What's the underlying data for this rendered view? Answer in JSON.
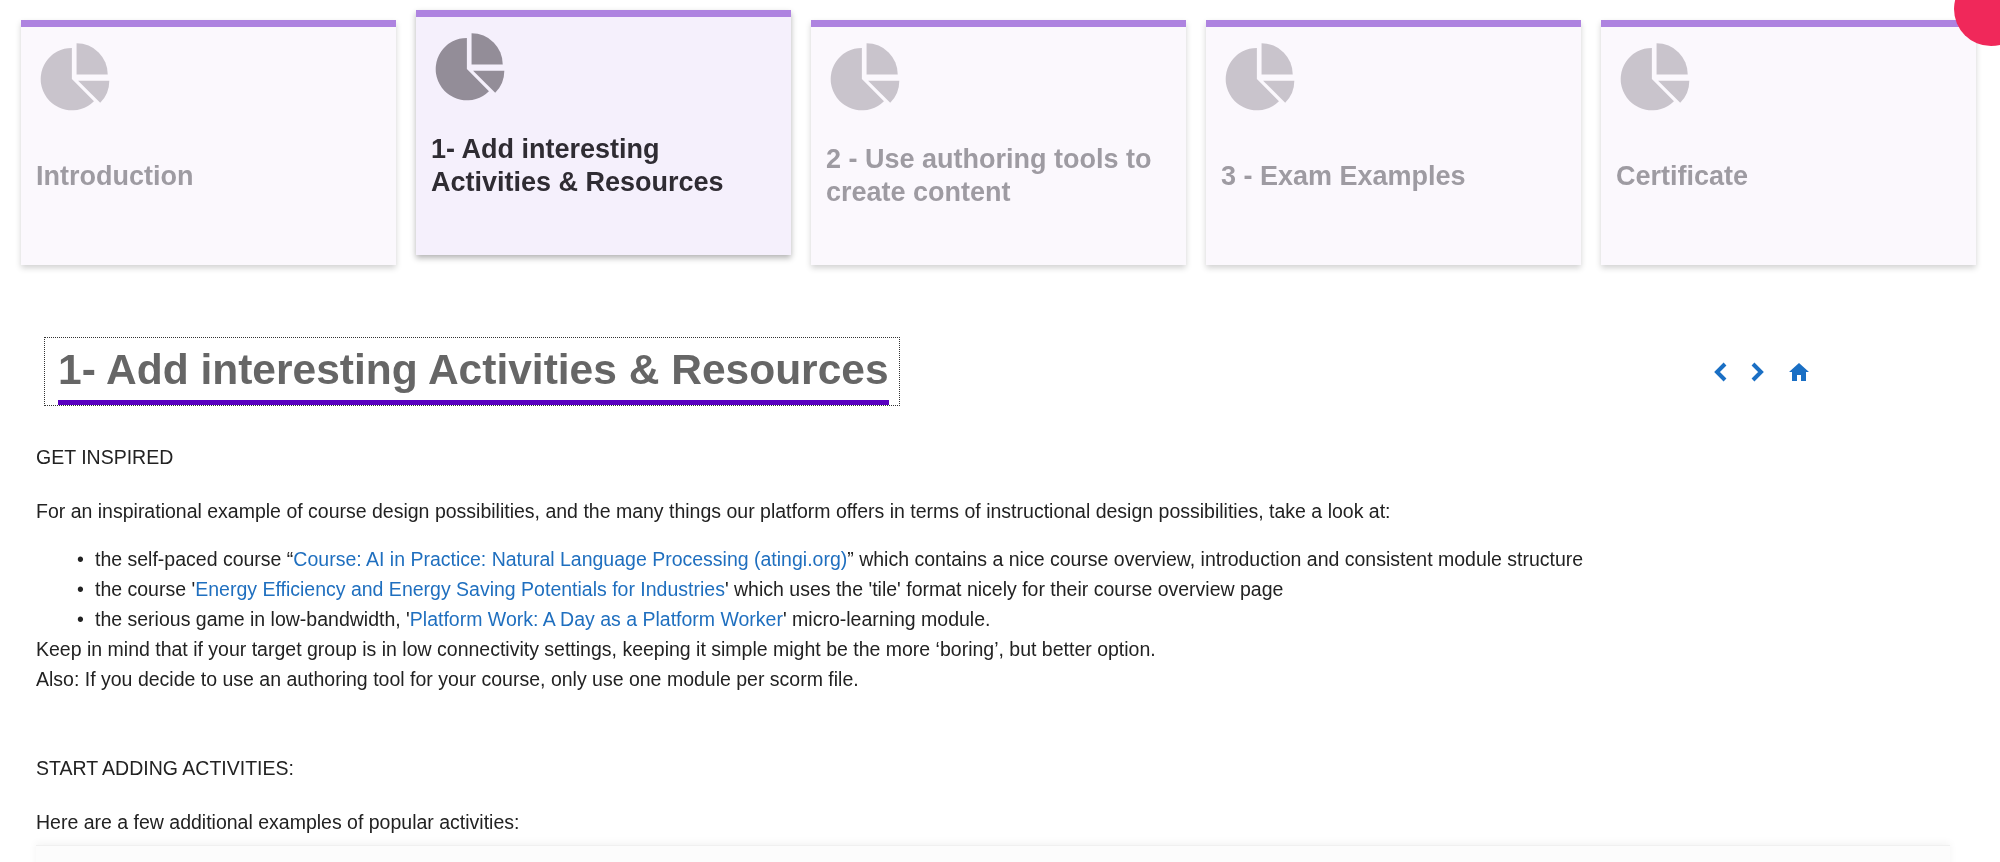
{
  "tiles": [
    {
      "title": "Introduction",
      "selected": false
    },
    {
      "title": "1- Add interesting Activities & Resources",
      "selected": true
    },
    {
      "title": "2 - Use authoring tools to create content",
      "selected": false
    },
    {
      "title": "3 - Exam Examples",
      "selected": false
    },
    {
      "title": "Certificate",
      "selected": false
    }
  ],
  "heading": "1- Add interesting Activities & Resources",
  "blocks": [
    {
      "kind": "paragraph",
      "spans": [
        {
          "kind": "text",
          "text": "GET INSPIRED"
        }
      ]
    },
    {
      "kind": "paragraph",
      "spans": [
        {
          "kind": "text",
          "text": "For an inspirational example of course design possibilities, and the many things our platform offers in terms of instructional design possibilities, take a look at:"
        }
      ]
    },
    {
      "kind": "list",
      "items": [
        {
          "marker": "•",
          "spans": [
            {
              "kind": "text",
              "text": "the self-paced course “"
            },
            {
              "kind": "link",
              "text": "Course: AI in Practice: Natural Language Processing (atingi.org)"
            },
            {
              "kind": "text",
              "text": "” which contains a nice course overview, introduction and consistent module structure"
            }
          ]
        },
        {
          "marker": "•",
          "spans": [
            {
              "kind": "text",
              "text": "the course '"
            },
            {
              "kind": "link",
              "text": "Energy Efficiency and Energy Saving Potentials for Industries"
            },
            {
              "kind": "text",
              "text": "' which uses the 'tile' format nicely for their course overview page"
            }
          ]
        },
        {
          "marker": "•",
          "spans": [
            {
              "kind": "text",
              "text": "the serious game in low-bandwidth, '"
            },
            {
              "kind": "link",
              "text": "Platform Work: A Day as a Platform Worker"
            },
            {
              "kind": "text",
              "text": "' micro-learning module."
            }
          ]
        }
      ]
    },
    {
      "kind": "line",
      "spans": [
        {
          "kind": "text",
          "text": "Keep in mind that if your target group is in low connectivity settings, keeping it simple might be the more ‘boring’, but better option."
        }
      ]
    },
    {
      "kind": "line",
      "spans": [
        {
          "kind": "text",
          "text": "Also: If you decide to use an authoring tool for your course, only use one module per scorm file."
        }
      ]
    },
    {
      "kind": "gap"
    },
    {
      "kind": "paragraph",
      "spans": [
        {
          "kind": "text",
          "text": "START ADDING ACTIVITIES:"
        }
      ]
    },
    {
      "kind": "paragraph",
      "spans": [
        {
          "kind": "text",
          "text": "Here are a few additional examples of popular activities:"
        }
      ]
    }
  ]
}
